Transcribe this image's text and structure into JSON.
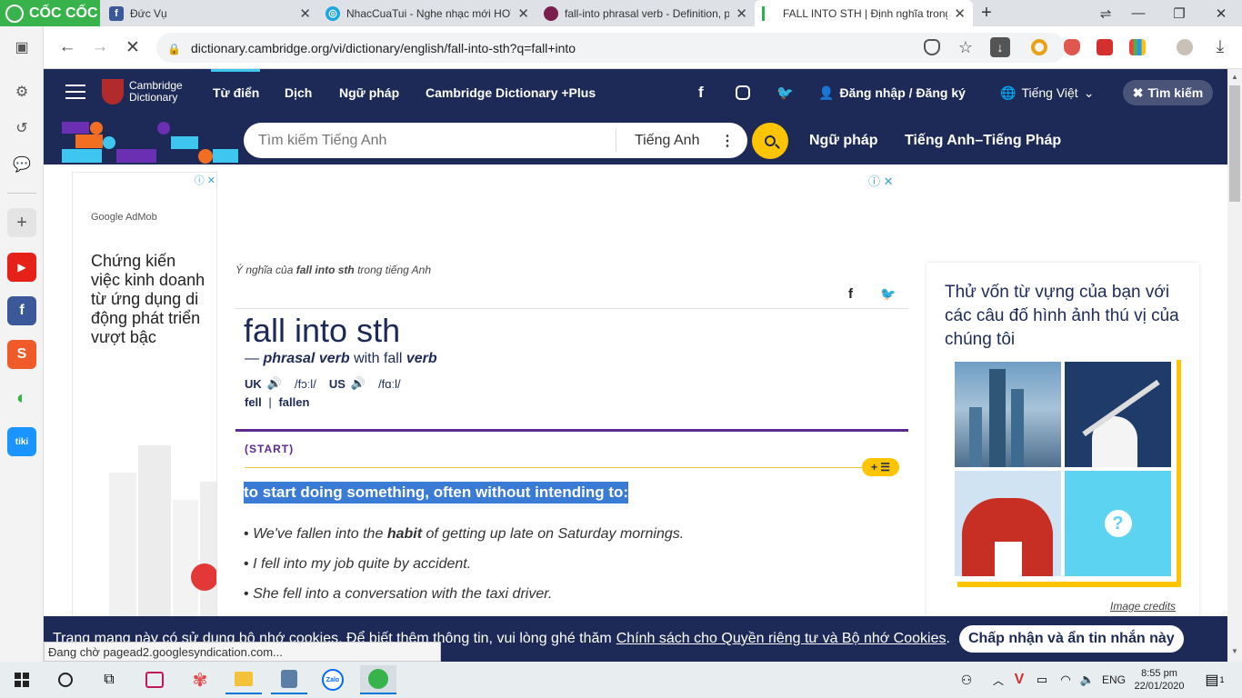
{
  "browser": {
    "brand": "CỐC CỐC",
    "tabs": [
      {
        "title": "Đức Vụ",
        "favicon": "facebook-icon",
        "color": "#3b5998"
      },
      {
        "title": "NhacCuaTui - Nghe nhạc mới HOT",
        "favicon": "nhaccuatui-icon",
        "color": "#1aa5e3"
      },
      {
        "title": "fall-into phrasal verb - Definition, p",
        "favicon": "oxford-icon",
        "color": "#7a1f4d"
      },
      {
        "title": "FALL INTO STH | Định nghĩa trong",
        "favicon": "cambridge-icon",
        "color": "#2bb24c"
      }
    ],
    "url": "dictionary.cambridge.org/vi/dictionary/english/fall-into-sth?q=fall+into",
    "status_text": "Đang chờ pagead2.googlesyndication.com..."
  },
  "site": {
    "logo_line1": "Cambridge",
    "logo_line2": "Dictionary",
    "nav": [
      "Từ điển",
      "Dịch",
      "Ngữ pháp",
      "Cambridge Dictionary +Plus"
    ],
    "login": "Đăng nhập / Đăng ký",
    "language": "Tiếng Việt",
    "search_toggle": "Tìm kiếm",
    "search_placeholder": "Tìm kiếm Tiếng Anh",
    "search_lang": "Tiếng Anh",
    "sub_links": [
      "Ngữ pháp",
      "Tiếng Anh–Tiếng Pháp"
    ]
  },
  "left_ad": {
    "brand_google": "Google",
    "brand_admob": "AdMob",
    "text": "Chứng kiến việc kinh doanh từ ứng dụng di động phát triển vượt bậc"
  },
  "entry": {
    "meaning_prefix": "Ý nghĩa của",
    "meaning_word": "fall into sth",
    "meaning_suffix": "trong tiếng Anh",
    "headword": "fall into sth",
    "dash": "—",
    "pos": "phrasal verb",
    "with_text": "with fall",
    "with_pos": "verb",
    "uk_label": "UK",
    "uk_ipa": "/fɔːl/",
    "us_label": "US",
    "us_ipa": "/fɑːl/",
    "form1": "fell",
    "form_sep": "|",
    "form2": "fallen",
    "guide": "(START)",
    "definition": "to start doing something, often without intending to:",
    "ex1_pre": "We've fallen into the",
    "ex1_bold": "habit",
    "ex1_post": "of getting up late on Saturday mornings.",
    "ex2": "I fell into my job quite by accident.",
    "ex3": "She fell into a conversation with the taxi driver."
  },
  "quiz": {
    "title": "Thử vốn từ vựng của bạn với các câu đố hình ảnh thú vị của chúng tôi",
    "credits": "Image credits"
  },
  "cookie": {
    "text": "Trang mạng này có sử dụng bộ nhớ cookies. Để biết thêm thông tin, vui lòng ghé thăm",
    "link": "Chính sách cho Quyền riêng tư và Bộ nhớ Cookies",
    "end": ".",
    "button": "Chấp nhận và ẩn tin nhắn này"
  },
  "taskbar": {
    "lang": "ENG",
    "time": "8:55 pm",
    "date": "22/01/2020",
    "notif_count": "1"
  },
  "colors": {
    "header": "#1d2a57",
    "accent_yellow": "#fec400",
    "purple": "#5b2a91",
    "highlight": "#3a7bd5",
    "brand_green": "#38b24a"
  }
}
